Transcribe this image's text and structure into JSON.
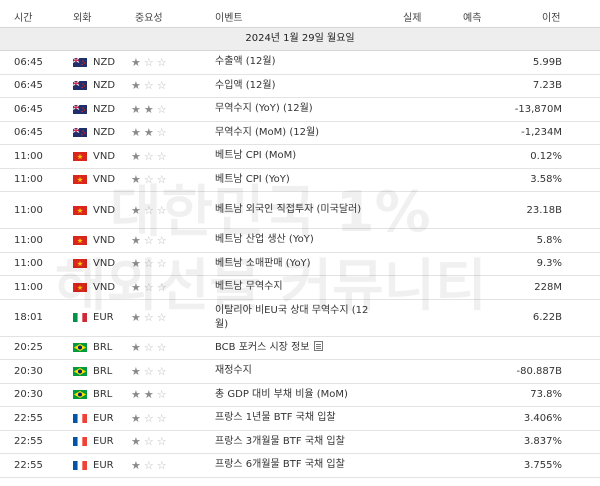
{
  "header": {
    "time": "시간",
    "currency": "외화",
    "importance": "중요성",
    "event": "이벤트",
    "actual": "실제",
    "forecast": "예측",
    "previous": "이전"
  },
  "date_label": "2024년 1월 29일 월요일",
  "watermark": [
    "대한민국 1%",
    "해외선물 커뮤니티"
  ],
  "colors": {
    "header_bg": "#ffffff",
    "date_bg": "#eeeeee",
    "star_on": "#8a8a8a",
    "star_off": "#b8b8b8"
  },
  "events": [
    {
      "time": "06:45",
      "flag": "nz-flag-icon",
      "currency": "NZD",
      "stars": 1,
      "event": "수출액 (12월)",
      "actual": "",
      "forecast": "",
      "previous": "5.99B",
      "lines": 1
    },
    {
      "time": "06:45",
      "flag": "nz-flag-icon",
      "currency": "NZD",
      "stars": 1,
      "event": "수입액 (12월)",
      "actual": "",
      "forecast": "",
      "previous": "7.23B",
      "lines": 1
    },
    {
      "time": "06:45",
      "flag": "nz-flag-icon",
      "currency": "NZD",
      "stars": 2,
      "event": "무역수지 (YoY) (12월)",
      "actual": "",
      "forecast": "",
      "previous": "-13,870M",
      "lines": 1
    },
    {
      "time": "06:45",
      "flag": "nz-flag-icon",
      "currency": "NZD",
      "stars": 2,
      "event": "무역수지 (MoM) (12월)",
      "actual": "",
      "forecast": "",
      "previous": "-1,234M",
      "lines": 1
    },
    {
      "time": "11:00",
      "flag": "vn-flag-icon",
      "currency": "VND",
      "stars": 1,
      "event": "베트남 CPI (MoM)",
      "actual": "",
      "forecast": "",
      "previous": "0.12%",
      "lines": 1
    },
    {
      "time": "11:00",
      "flag": "vn-flag-icon",
      "currency": "VND",
      "stars": 1,
      "event": "베트남 CPI (YoY)",
      "actual": "",
      "forecast": "",
      "previous": "3.58%",
      "lines": 1
    },
    {
      "time": "11:00",
      "flag": "vn-flag-icon",
      "currency": "VND",
      "stars": 1,
      "event": "베트남 외국인 직접투자 (미국달러)",
      "actual": "",
      "forecast": "",
      "previous": "23.18B",
      "lines": 2
    },
    {
      "time": "11:00",
      "flag": "vn-flag-icon",
      "currency": "VND",
      "stars": 1,
      "event": "베트남 산업 생산 (YoY)",
      "actual": "",
      "forecast": "",
      "previous": "5.8%",
      "lines": 1
    },
    {
      "time": "11:00",
      "flag": "vn-flag-icon",
      "currency": "VND",
      "stars": 1,
      "event": "베트남 소매판매 (YoY)",
      "actual": "",
      "forecast": "",
      "previous": "9.3%",
      "lines": 1
    },
    {
      "time": "11:00",
      "flag": "vn-flag-icon",
      "currency": "VND",
      "stars": 1,
      "event": "베트남 무역수지",
      "actual": "",
      "forecast": "",
      "previous": "228M",
      "lines": 1
    },
    {
      "time": "18:01",
      "flag": "it-flag-icon",
      "currency": "EUR",
      "stars": 1,
      "event": "이탈리아 비EU국 상대 무역수지 (12월)",
      "actual": "",
      "forecast": "",
      "previous": "6.22B",
      "lines": 2
    },
    {
      "time": "20:25",
      "flag": "br-flag-icon",
      "currency": "BRL",
      "stars": 1,
      "event": "BCB 포커스 시장 정보",
      "actual": "",
      "forecast": "",
      "previous": "",
      "lines": 1,
      "doc": true
    },
    {
      "time": "20:30",
      "flag": "br-flag-icon",
      "currency": "BRL",
      "stars": 1,
      "event": "재정수지",
      "actual": "",
      "forecast": "",
      "previous": "-80.887B",
      "lines": 1
    },
    {
      "time": "20:30",
      "flag": "br-flag-icon",
      "currency": "BRL",
      "stars": 2,
      "event": "총 GDP 대비 부채 비율 (MoM)",
      "actual": "",
      "forecast": "",
      "previous": "73.8%",
      "lines": 1
    },
    {
      "time": "22:55",
      "flag": "fr-flag-icon",
      "currency": "EUR",
      "stars": 1,
      "event": "프랑스 1년물 BTF 국채 입찰",
      "actual": "",
      "forecast": "",
      "previous": "3.406%",
      "lines": 1
    },
    {
      "time": "22:55",
      "flag": "fr-flag-icon",
      "currency": "EUR",
      "stars": 1,
      "event": "프랑스 3개월물 BTF 국채 입찰",
      "actual": "",
      "forecast": "",
      "previous": "3.837%",
      "lines": 1
    },
    {
      "time": "22:55",
      "flag": "fr-flag-icon",
      "currency": "EUR",
      "stars": 1,
      "event": "프랑스 6개월물 BTF 국채 입찰",
      "actual": "",
      "forecast": "",
      "previous": "3.755%",
      "lines": 1
    }
  ]
}
